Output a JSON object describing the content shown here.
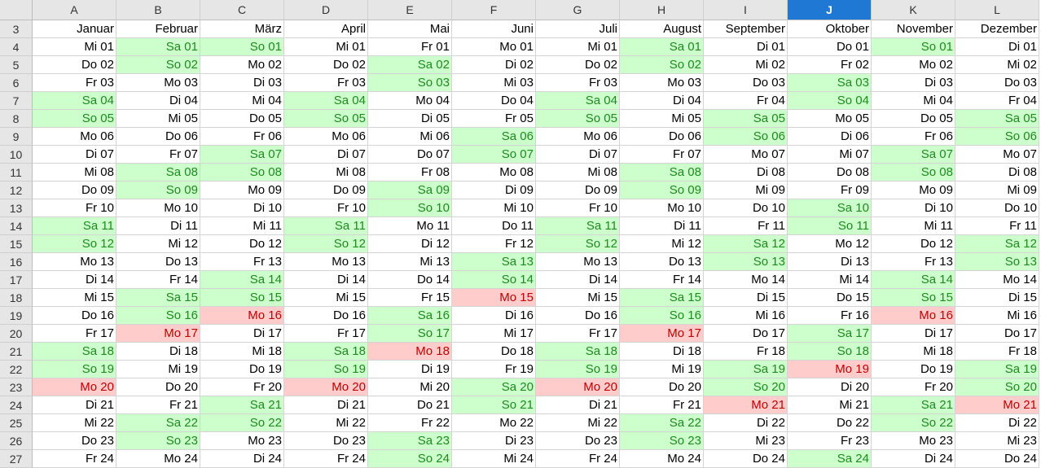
{
  "columns": [
    "A",
    "B",
    "C",
    "D",
    "E",
    "F",
    "G",
    "H",
    "I",
    "J",
    "K",
    "L"
  ],
  "active_column": "J",
  "row_numbers": [
    "3",
    "4",
    "5",
    "6",
    "7",
    "8",
    "9",
    "10",
    "11",
    "12",
    "13",
    "14",
    "15",
    "16",
    "17",
    "18",
    "19",
    "20",
    "21",
    "22",
    "23",
    "24",
    "25",
    "26",
    "27"
  ],
  "months": [
    "Januar",
    "Februar",
    "März",
    "April",
    "Mai",
    "Juni",
    "Juli",
    "August",
    "September",
    "Oktober",
    "November",
    "Dezember"
  ],
  "colors": {
    "weekend_fill": "#ccffcc",
    "weekend_text": "#1f8a1f",
    "holiday_fill": "#ffcccc",
    "holiday_text": "#c00000",
    "active_header": "#1e78d4"
  },
  "highlights": [
    [
      "Mo 20"
    ],
    [
      "Mo 17"
    ],
    [
      "Mo 16"
    ],
    [
      "Mo 20"
    ],
    [
      "Mo 18"
    ],
    [
      "Mo 15"
    ],
    [
      "Mo 20"
    ],
    [
      "Mo 17"
    ],
    [
      "Mo 21"
    ],
    [
      "Mo 19"
    ],
    [
      "Mo 16"
    ],
    [
      "Mo 21"
    ]
  ],
  "days": [
    [
      "Mi 01",
      "Do 02",
      "Fr 03",
      "Sa 04",
      "So 05",
      "Mo 06",
      "Di 07",
      "Mi 08",
      "Do 09",
      "Fr 10",
      "Sa 11",
      "So 12",
      "Mo 13",
      "Di 14",
      "Mi 15",
      "Do 16",
      "Fr 17",
      "Sa 18",
      "So 19",
      "Mo 20",
      "Di 21",
      "Mi 22",
      "Do 23",
      "Fr 24"
    ],
    [
      "Sa 01",
      "So 02",
      "Mo 03",
      "Di 04",
      "Mi 05",
      "Do 06",
      "Fr 07",
      "Sa 08",
      "So 09",
      "Mo 10",
      "Di 11",
      "Mi 12",
      "Do 13",
      "Fr 14",
      "Sa 15",
      "So 16",
      "Mo 17",
      "Di 18",
      "Mi 19",
      "Do 20",
      "Fr 21",
      "Sa 22",
      "So 23",
      "Mo 24"
    ],
    [
      "So 01",
      "Mo 02",
      "Di 03",
      "Mi 04",
      "Do 05",
      "Fr 06",
      "Sa 07",
      "So 08",
      "Mo 09",
      "Di 10",
      "Mi 11",
      "Do 12",
      "Fr 13",
      "Sa 14",
      "So 15",
      "Mo 16",
      "Di 17",
      "Mi 18",
      "Do 19",
      "Fr 20",
      "Sa 21",
      "So 22",
      "Mo 23",
      "Di 24"
    ],
    [
      "Mi 01",
      "Do 02",
      "Fr 03",
      "Sa 04",
      "So 05",
      "Mo 06",
      "Di 07",
      "Mi 08",
      "Do 09",
      "Fr 10",
      "Sa 11",
      "So 12",
      "Mo 13",
      "Di 14",
      "Mi 15",
      "Do 16",
      "Fr 17",
      "Sa 18",
      "So 19",
      "Mo 20",
      "Di 21",
      "Mi 22",
      "Do 23",
      "Fr 24"
    ],
    [
      "Fr 01",
      "Sa 02",
      "So 03",
      "Mo 04",
      "Di 05",
      "Mi 06",
      "Do 07",
      "Fr 08",
      "Sa 09",
      "So 10",
      "Mo 11",
      "Di 12",
      "Mi 13",
      "Do 14",
      "Fr 15",
      "Sa 16",
      "So 17",
      "Mo 18",
      "Di 19",
      "Mi 20",
      "Do 21",
      "Fr 22",
      "Sa 23",
      "So 24"
    ],
    [
      "Mo 01",
      "Di 02",
      "Mi 03",
      "Do 04",
      "Fr 05",
      "Sa 06",
      "So 07",
      "Mo 08",
      "Di 09",
      "Mi 10",
      "Do 11",
      "Fr 12",
      "Sa 13",
      "So 14",
      "Mo 15",
      "Di 16",
      "Mi 17",
      "Do 18",
      "Fr 19",
      "Sa 20",
      "So 21",
      "Mo 22",
      "Di 23",
      "Mi 24"
    ],
    [
      "Mi 01",
      "Do 02",
      "Fr 03",
      "Sa 04",
      "So 05",
      "Mo 06",
      "Di 07",
      "Mi 08",
      "Do 09",
      "Fr 10",
      "Sa 11",
      "So 12",
      "Mo 13",
      "Di 14",
      "Mi 15",
      "Do 16",
      "Fr 17",
      "Sa 18",
      "So 19",
      "Mo 20",
      "Di 21",
      "Mi 22",
      "Do 23",
      "Fr 24"
    ],
    [
      "Sa 01",
      "So 02",
      "Mo 03",
      "Di 04",
      "Mi 05",
      "Do 06",
      "Fr 07",
      "Sa 08",
      "So 09",
      "Mo 10",
      "Di 11",
      "Mi 12",
      "Do 13",
      "Fr 14",
      "Sa 15",
      "So 16",
      "Mo 17",
      "Di 18",
      "Mi 19",
      "Do 20",
      "Fr 21",
      "Sa 22",
      "So 23",
      "Mo 24"
    ],
    [
      "Di 01",
      "Mi 02",
      "Do 03",
      "Fr 04",
      "Sa 05",
      "So 06",
      "Mo 07",
      "Di 08",
      "Mi 09",
      "Do 10",
      "Fr 11",
      "Sa 12",
      "So 13",
      "Mo 14",
      "Di 15",
      "Mi 16",
      "Do 17",
      "Fr 18",
      "Sa 19",
      "So 20",
      "Mo 21",
      "Di 22",
      "Mi 23",
      "Do 24"
    ],
    [
      "Do 01",
      "Fr 02",
      "Sa 03",
      "So 04",
      "Mo 05",
      "Di 06",
      "Mi 07",
      "Do 08",
      "Fr 09",
      "Sa 10",
      "So 11",
      "Mo 12",
      "Di 13",
      "Mi 14",
      "Do 15",
      "Fr 16",
      "Sa 17",
      "So 18",
      "Mo 19",
      "Di 20",
      "Mi 21",
      "Do 22",
      "Fr 23",
      "Sa 24"
    ],
    [
      "So 01",
      "Mo 02",
      "Di 03",
      "Mi 04",
      "Do 05",
      "Fr 06",
      "Sa 07",
      "So 08",
      "Mo 09",
      "Di 10",
      "Mi 11",
      "Do 12",
      "Fr 13",
      "Sa 14",
      "So 15",
      "Mo 16",
      "Di 17",
      "Mi 18",
      "Do 19",
      "Fr 20",
      "Sa 21",
      "So 22",
      "Mo 23",
      "Di 24"
    ],
    [
      "Di 01",
      "Mi 02",
      "Do 03",
      "Fr 04",
      "Sa 05",
      "So 06",
      "Mo 07",
      "Di 08",
      "Mi 09",
      "Do 10",
      "Fr 11",
      "Sa 12",
      "So 13",
      "Mo 14",
      "Di 15",
      "Mi 16",
      "Do 17",
      "Fr 18",
      "Sa 19",
      "So 20",
      "Mo 21",
      "Di 22",
      "Mi 23",
      "Do 24"
    ]
  ]
}
